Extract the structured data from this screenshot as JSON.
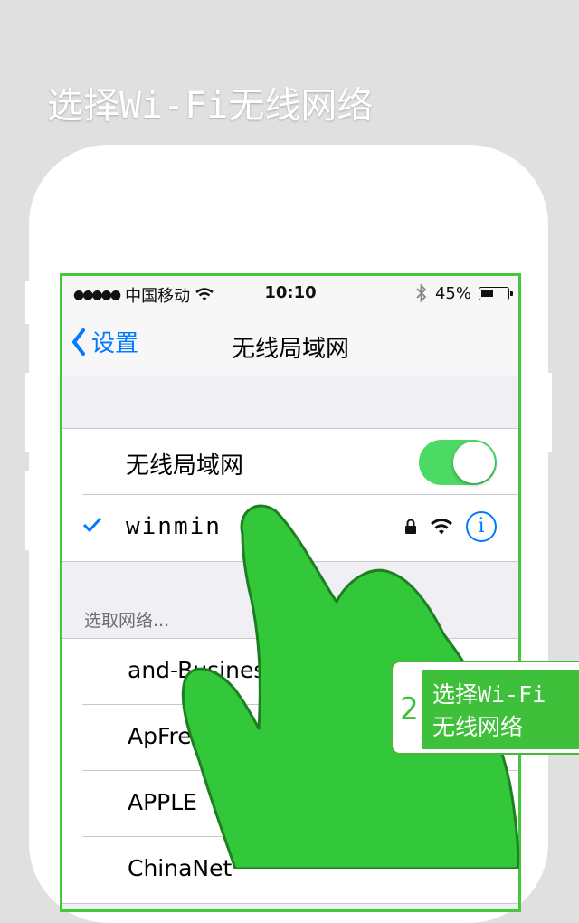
{
  "headline": "选择Wi-Fi无线网络",
  "status_bar": {
    "carrier": "中国移动",
    "time": "10:10",
    "battery": "45%",
    "battery_level": 0.45
  },
  "nav": {
    "back_label": "设置",
    "title": "无线局域网"
  },
  "wifi_toggle": {
    "label": "无线局域网",
    "on": true
  },
  "connected_network": {
    "name": "winmin",
    "info_glyph": "i"
  },
  "section_header": "选取网络...",
  "networks": [
    {
      "name": "and-Business"
    },
    {
      "name": "ApFree-5205"
    },
    {
      "name": "APPLE"
    },
    {
      "name": "ChinaNet"
    }
  ],
  "callout": {
    "number": "2",
    "line1": "选择Wi-Fi",
    "line2": "无线网络"
  },
  "colors": {
    "accent_green": "#3fc03a",
    "ios_blue": "#007aff",
    "toggle_green": "#4cd964",
    "background": "#e0e0e0"
  }
}
